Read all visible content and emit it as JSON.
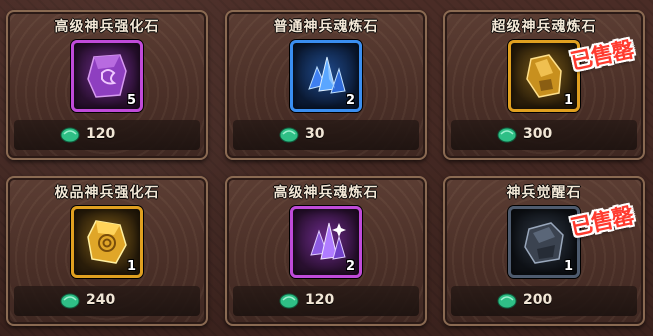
{
  "shop": {
    "items": [
      {
        "title": "高级神兵强化石",
        "count": "5",
        "price": "120",
        "rarity": "purple",
        "icon": "purple-rune-stone-icon",
        "sold_out": ""
      },
      {
        "title": "普通神兵魂炼石",
        "count": "2",
        "price": "30",
        "rarity": "blue",
        "icon": "blue-crystal-icon",
        "sold_out": ""
      },
      {
        "title": "超级神兵魂炼石",
        "count": "1",
        "price": "300",
        "rarity": "gold",
        "icon": "gold-ore-icon",
        "sold_out": "已售罄"
      },
      {
        "title": "极品神兵强化石",
        "count": "1",
        "price": "240",
        "rarity": "gold",
        "icon": "gold-rune-stone-icon",
        "sold_out": ""
      },
      {
        "title": "高级神兵魂炼石",
        "count": "2",
        "price": "120",
        "rarity": "purple",
        "icon": "purple-crystal-icon",
        "sold_out": ""
      },
      {
        "title": "神兵觉醒石",
        "count": "1",
        "price": "200",
        "rarity": "dark",
        "icon": "dark-stone-icon",
        "sold_out": "已售罄"
      }
    ],
    "currency_icon": "green-jade-icon",
    "colors": {
      "purple": "#c04bd9",
      "blue": "#3a8ef0",
      "gold": "#e0a020",
      "dark": "#4e5b6e",
      "sold": "#ff3b2f"
    }
  }
}
